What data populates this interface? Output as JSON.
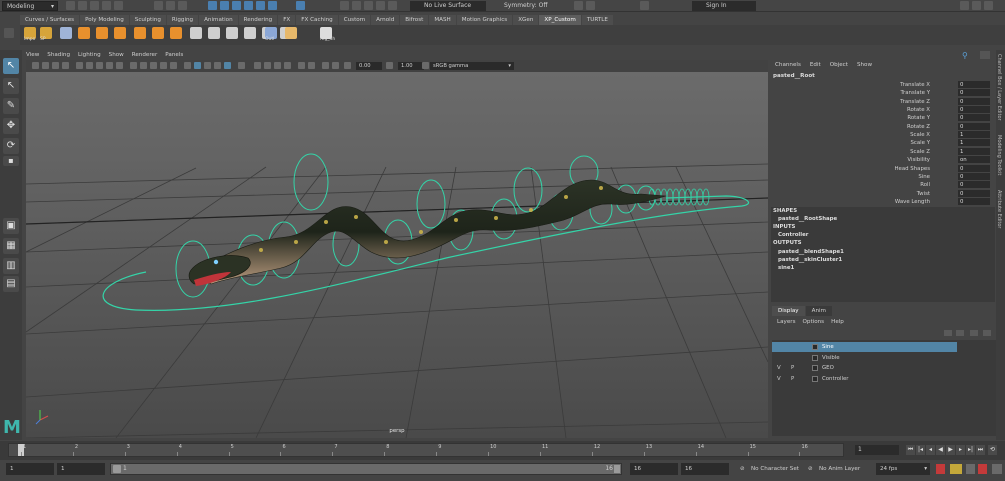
{
  "topbar": {
    "mode": "Modeling",
    "live_surface": "No Live Surface",
    "symmetry": "Symmetry: Off",
    "signin": "Sign In"
  },
  "shelf_tabs": [
    "Curves / Surfaces",
    "Poly Modeling",
    "Sculpting",
    "Rigging",
    "Animation",
    "Rendering",
    "FX",
    "FX Caching",
    "Custom",
    "Arnold",
    "Bifrost",
    "MASH",
    "Motion Graphics",
    "XGen",
    "XP_Custom",
    "TURTLE"
  ],
  "shelf_active": "XP_Custom",
  "shelf_icons": [
    {
      "name": "impo-icon",
      "label": "Impo",
      "color": "#d6a43a"
    },
    {
      "name": "sp-icon",
      "label": "SP",
      "color": "#d6a43a"
    },
    {
      "name": "snowflake-icon",
      "label": "",
      "color": "#9fb4d8"
    },
    {
      "name": "cube-icon",
      "label": "",
      "color": "#e8902d"
    },
    {
      "name": "cube-orange-icon",
      "label": "",
      "color": "#e8902d"
    },
    {
      "name": "leaf-icon",
      "label": "",
      "color": "#e8902d"
    },
    {
      "name": "diamond-icon",
      "label": "",
      "color": "#e8902d"
    },
    {
      "name": "cube-small-icon",
      "label": "",
      "color": "#e8902d"
    },
    {
      "name": "node-link-icon",
      "label": "",
      "color": "#e8902d"
    },
    {
      "name": "nodes-icon",
      "label": "",
      "color": "#cfcfcf"
    },
    {
      "name": "curve-icon",
      "label": "",
      "color": "#cfcfcf"
    },
    {
      "name": "brush-icon",
      "label": "",
      "color": "#cfcfcf"
    },
    {
      "name": "knife-icon",
      "label": "",
      "color": "#cfcfcf"
    },
    {
      "name": "tag-icon",
      "label": "",
      "color": "#cfcfcf"
    },
    {
      "name": "dots-icon",
      "label": "",
      "color": "#cfcfcf"
    },
    {
      "name": "outliner-icon",
      "label": "Outl",
      "color": "#8ba7d6"
    },
    {
      "name": "avatar-icon",
      "label": "",
      "color": "#e7b86a"
    },
    {
      "name": "rig-icon",
      "label": "Rig_Sh",
      "color": "#dddddd"
    }
  ],
  "panel_menu": [
    "View",
    "Shading",
    "Lighting",
    "Show",
    "Renderer",
    "Panels"
  ],
  "viewport": {
    "exposure": "0.00",
    "gamma": "1.00",
    "colorspace": "sRGB gamma",
    "camera": "persp"
  },
  "channel_box": {
    "menu": [
      "Channels",
      "Edit",
      "Object",
      "Show"
    ],
    "node": "pasted__Root",
    "attributes": [
      {
        "name": "Translate X",
        "value": "0"
      },
      {
        "name": "Translate Y",
        "value": "0"
      },
      {
        "name": "Translate Z",
        "value": "0"
      },
      {
        "name": "Rotate X",
        "value": "0"
      },
      {
        "name": "Rotate Y",
        "value": "0"
      },
      {
        "name": "Rotate Z",
        "value": "0"
      },
      {
        "name": "Scale X",
        "value": "1"
      },
      {
        "name": "Scale Y",
        "value": "1"
      },
      {
        "name": "Scale Z",
        "value": "1"
      },
      {
        "name": "Visibility",
        "value": "on"
      },
      {
        "name": "Head Shapes",
        "value": "0"
      },
      {
        "name": "Sine",
        "value": "0"
      },
      {
        "name": "Roll",
        "value": "0"
      },
      {
        "name": "Twist",
        "value": "0"
      },
      {
        "name": "Wave Length",
        "value": "0"
      }
    ],
    "shapes_label": "SHAPES",
    "shapes": [
      "pasted__RootShape"
    ],
    "inputs_label": "INPUTS",
    "inputs": [
      "Controller"
    ],
    "outputs_label": "OUTPUTS",
    "outputs": [
      "pasted__blendShape1",
      "pasted__skinCluster1",
      "sine1"
    ]
  },
  "layer_editor": {
    "tabs": [
      "Display",
      "Anim"
    ],
    "active_tab": "Display",
    "menu": [
      "Layers",
      "Options",
      "Help"
    ],
    "layers": [
      {
        "v": "",
        "p": "",
        "name": "Sine",
        "selected": true
      },
      {
        "v": "",
        "p": "",
        "name": "Visible",
        "selected": false
      },
      {
        "v": "V",
        "p": "P",
        "name": "GEO",
        "selected": false
      },
      {
        "v": "V",
        "p": "P",
        "name": "Controller",
        "selected": false
      }
    ]
  },
  "right_tabs": [
    "Channel Box / Layer Editor",
    "Modeling Toolkit",
    "Attribute Editor"
  ],
  "timeline": {
    "ticks": [
      "1",
      "2",
      "3",
      "4",
      "5",
      "6",
      "7",
      "8",
      "9",
      "10",
      "11",
      "12",
      "13",
      "14",
      "15",
      "16"
    ],
    "current_frame": "1"
  },
  "range": {
    "start": "1",
    "anim_start": "1",
    "slider_start": "1",
    "slider_end": "16",
    "anim_end": "16",
    "end": "16",
    "character_set": "No Character Set",
    "anim_layer": "No Anim Layer",
    "fps": "24 fps"
  }
}
